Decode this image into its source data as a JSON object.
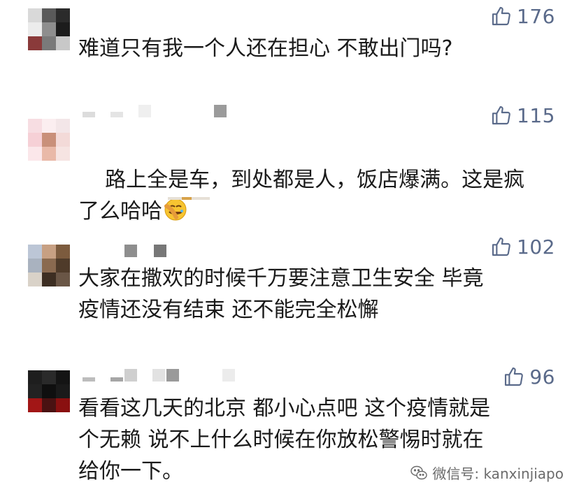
{
  "comments": [
    {
      "likes": "176",
      "text": "难道只有我一个人还在担心 不敢出门吗?"
    },
    {
      "likes": "115",
      "text": "路上全是车，到处都是人，饭店爆满。这是疯\n了么哈哈",
      "emoji": "facepalm-laughing"
    },
    {
      "likes": "102",
      "text": "大家在撒欢的时候千万要注意卫生安全 毕竟\n疫情还没有结束 还不能完全松懈"
    },
    {
      "likes": "96",
      "text": "看看这几天的北京 都小心点吧 这个疫情就是\n个无赖 说不上什么时候在你放松警惕时就在\n给你一下。"
    }
  ],
  "watermark": {
    "text": "微信号: kanxinjiapo"
  },
  "colors": {
    "like": "#5a6a8a",
    "text": "#1a1a1a"
  }
}
